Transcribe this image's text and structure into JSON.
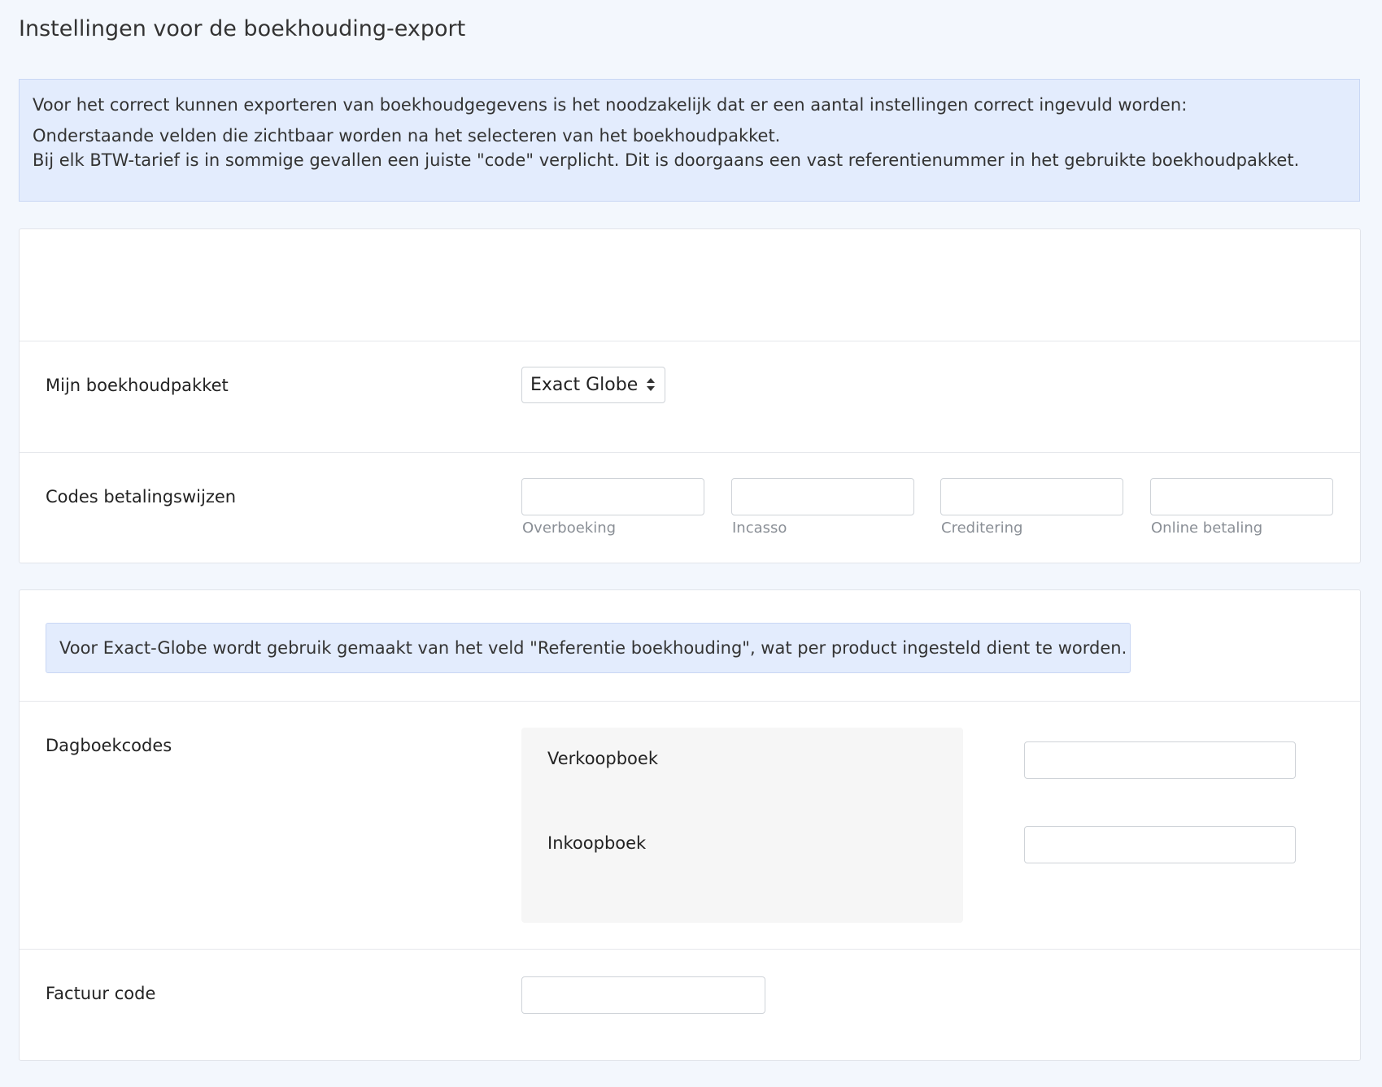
{
  "page": {
    "title": "Instellingen voor de boekhouding-export"
  },
  "info": {
    "line1": "Voor het correct kunnen exporteren van boekhoudgegevens is het noodzakelijk dat er een aantal instellingen correct ingevuld worden:",
    "line2": "Onderstaande velden die zichtbaar worden na het selecteren van het boekhoudpakket.",
    "line3": "Bij elk BTW-tarief is in sommige gevallen een juiste \"code\" verplicht. Dit is doorgaans een vast referentienummer in het gebruikte boekhoudpakket."
  },
  "package": {
    "label": "Mijn boekhoudpakket",
    "selected": "Exact Globe"
  },
  "payment_codes": {
    "label": "Codes betalingswijzen",
    "fields": [
      {
        "hint": "Overboeking",
        "value": ""
      },
      {
        "hint": "Incasso",
        "value": ""
      },
      {
        "hint": "Creditering",
        "value": ""
      },
      {
        "hint": "Online betaling",
        "value": ""
      }
    ]
  },
  "notice": {
    "text": "Voor Exact-Globe wordt gebruik gemaakt van het veld \"Referentie boekhouding\", wat per product ingesteld dient te worden."
  },
  "journal_codes": {
    "label": "Dagboekcodes",
    "items": [
      {
        "label": "Verkoopboek",
        "value": ""
      },
      {
        "label": "Inkoopboek",
        "value": ""
      }
    ]
  },
  "invoice_code": {
    "label": "Factuur code",
    "value": ""
  }
}
